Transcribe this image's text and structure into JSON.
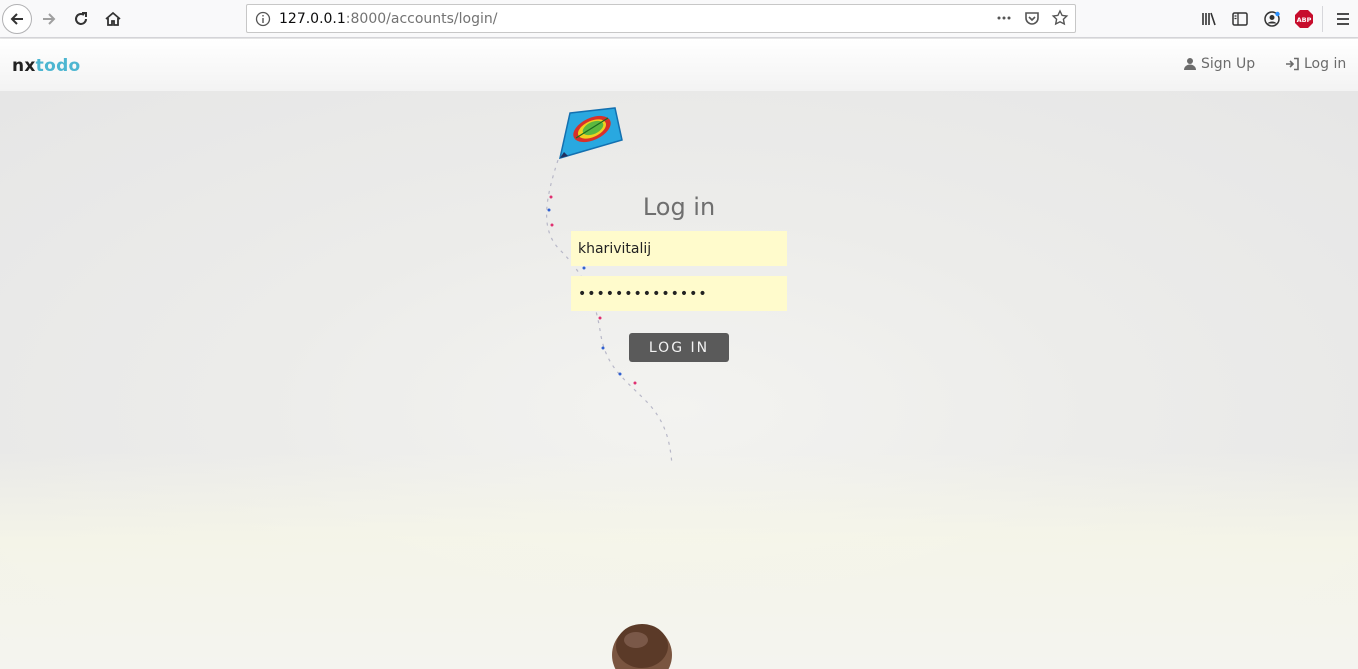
{
  "browser": {
    "url_host": "127.0.0.1",
    "url_path": ":8000/accounts/login/"
  },
  "navbar": {
    "brand_part1": "nx",
    "brand_part2": "todo",
    "signup_label": "Sign Up",
    "login_label": "Log in"
  },
  "form": {
    "title": "Log in",
    "username_value": "kharivitalij",
    "password_value": "••••••••••••••",
    "submit_label": "LOG IN"
  },
  "colors": {
    "brand_accent": "#4db6d1",
    "autofill_bg": "#fffbcc",
    "button_bg": "#5a5a5a"
  }
}
